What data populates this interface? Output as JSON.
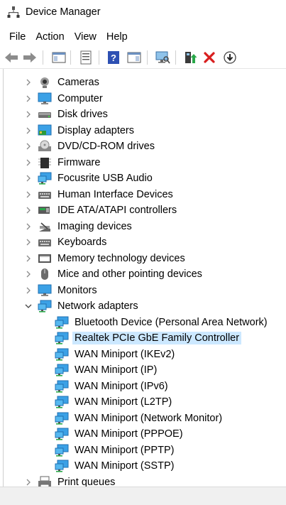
{
  "window": {
    "title": "Device Manager"
  },
  "menu": [
    {
      "label": "File"
    },
    {
      "label": "Action"
    },
    {
      "label": "View"
    },
    {
      "label": "Help"
    }
  ],
  "toolbar": [
    {
      "name": "back-icon",
      "glyph": "back"
    },
    {
      "name": "forward-icon",
      "glyph": "forward"
    },
    {
      "name": "show-hide-console-tree-icon",
      "glyph": "panel"
    },
    {
      "name": "properties-icon",
      "glyph": "props"
    },
    {
      "name": "help-icon",
      "glyph": "help"
    },
    {
      "name": "action-pane-icon",
      "glyph": "panel2"
    },
    {
      "name": "scan-hardware-icon",
      "glyph": "monitor"
    },
    {
      "name": "update-driver-icon",
      "glyph": "update"
    },
    {
      "name": "uninstall-device-icon",
      "glyph": "x"
    },
    {
      "name": "disable-device-icon",
      "glyph": "down"
    }
  ],
  "tree": [
    {
      "label": "Cameras",
      "icon": "camera",
      "level": 0,
      "expanded": false
    },
    {
      "label": "Computer",
      "icon": "computer",
      "level": 0,
      "expanded": false
    },
    {
      "label": "Disk drives",
      "icon": "disk",
      "level": 0,
      "expanded": false
    },
    {
      "label": "Display adapters",
      "icon": "display",
      "level": 0,
      "expanded": false
    },
    {
      "label": "DVD/CD-ROM drives",
      "icon": "dvd",
      "level": 0,
      "expanded": false
    },
    {
      "label": "Firmware",
      "icon": "chip",
      "level": 0,
      "expanded": false
    },
    {
      "label": "Focusrite USB Audio",
      "icon": "network",
      "level": 0,
      "expanded": false
    },
    {
      "label": "Human Interface Devices",
      "icon": "keyboard",
      "level": 0,
      "expanded": false
    },
    {
      "label": "IDE ATA/ATAPI controllers",
      "icon": "ide",
      "level": 0,
      "expanded": false
    },
    {
      "label": "Imaging devices",
      "icon": "imaging",
      "level": 0,
      "expanded": false
    },
    {
      "label": "Keyboards",
      "icon": "keyboard",
      "level": 0,
      "expanded": false
    },
    {
      "label": "Memory technology devices",
      "icon": "memory",
      "level": 0,
      "expanded": false
    },
    {
      "label": "Mice and other pointing devices",
      "icon": "mouse",
      "level": 0,
      "expanded": false
    },
    {
      "label": "Monitors",
      "icon": "computer",
      "level": 0,
      "expanded": false
    },
    {
      "label": "Network adapters",
      "icon": "network",
      "level": 0,
      "expanded": true
    },
    {
      "label": "Bluetooth Device (Personal Area Network)",
      "icon": "network",
      "level": 1
    },
    {
      "label": "Realtek PCIe GbE Family Controller",
      "icon": "network",
      "level": 1,
      "selected": true
    },
    {
      "label": "WAN Miniport (IKEv2)",
      "icon": "network",
      "level": 1
    },
    {
      "label": "WAN Miniport (IP)",
      "icon": "network",
      "level": 1
    },
    {
      "label": "WAN Miniport (IPv6)",
      "icon": "network",
      "level": 1
    },
    {
      "label": "WAN Miniport (L2TP)",
      "icon": "network",
      "level": 1
    },
    {
      "label": "WAN Miniport (Network Monitor)",
      "icon": "network",
      "level": 1
    },
    {
      "label": "WAN Miniport (PPPOE)",
      "icon": "network",
      "level": 1
    },
    {
      "label": "WAN Miniport (PPTP)",
      "icon": "network",
      "level": 1
    },
    {
      "label": "WAN Miniport (SSTP)",
      "icon": "network",
      "level": 1
    },
    {
      "label": "Print queues",
      "icon": "printer",
      "level": 0,
      "expanded": false
    }
  ],
  "colors": {
    "selection": "#cce8ff",
    "accent": "#1e8fd6",
    "delete": "#d81e1e"
  }
}
